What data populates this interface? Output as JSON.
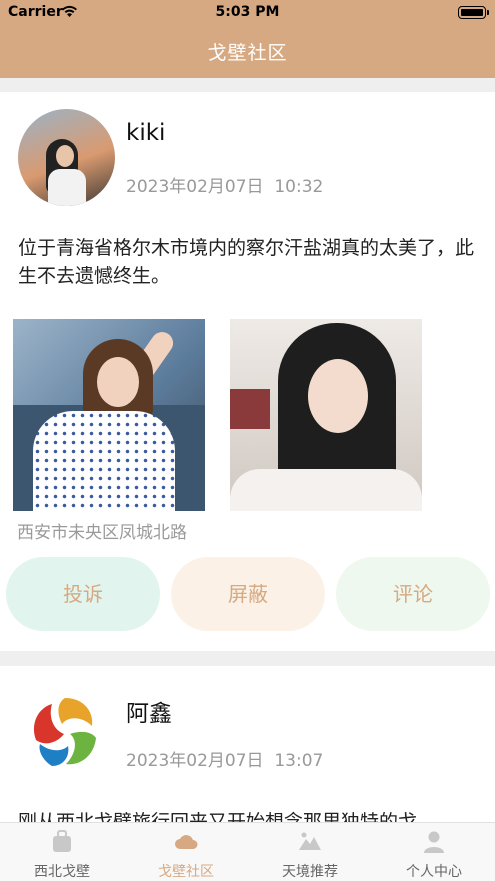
{
  "status_bar": {
    "carrier": "Carrier",
    "time": "5:03 PM"
  },
  "header": {
    "title": "戈壁社区"
  },
  "posts": [
    {
      "username": "kiki",
      "date": "2023年02月07日",
      "time": "10:32",
      "content": "位于青海省格尔木市境内的察尔汗盐湖真的太美了，此生不去遗憾终生。",
      "location": "西安市未央区凤城北路",
      "actions": {
        "complain": "投诉",
        "block": "屏蔽",
        "comment": "评论"
      }
    },
    {
      "username": "阿鑫",
      "date": "2023年02月07日",
      "time": "13:07",
      "content": "刚从西北戈壁旅行回来又开始想念那里独特的戈"
    }
  ],
  "tabbar": {
    "items": [
      {
        "label": "西北戈壁",
        "icon": "bag-icon"
      },
      {
        "label": "戈壁社区",
        "icon": "cloud-icon"
      },
      {
        "label": "天境推荐",
        "icon": "mountain-picture-icon"
      },
      {
        "label": "个人中心",
        "icon": "person-icon"
      }
    ],
    "active_index": 1
  },
  "colors": {
    "accent": "#d6a982"
  }
}
